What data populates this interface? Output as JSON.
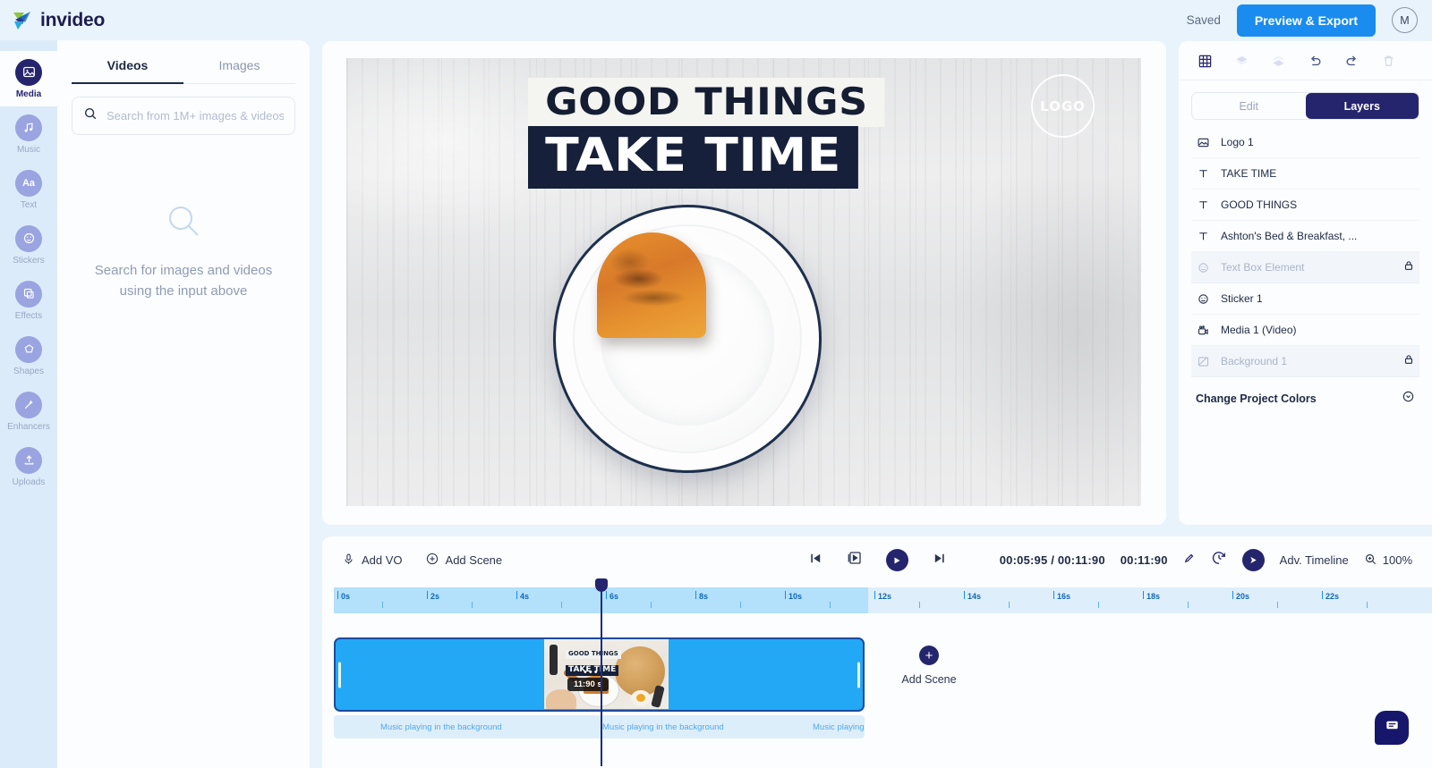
{
  "header": {
    "brand": "invideo",
    "saved_status": "Saved",
    "preview_export_label": "Preview & Export",
    "avatar_initial": "M"
  },
  "rail": {
    "items": [
      {
        "label": "Media",
        "icon": "image-icon",
        "active": true
      },
      {
        "label": "Music",
        "icon": "music-icon",
        "active": false
      },
      {
        "label": "Text",
        "icon": "text-aa-icon",
        "active": false
      },
      {
        "label": "Stickers",
        "icon": "sticker-icon",
        "active": false
      },
      {
        "label": "Effects",
        "icon": "effects-icon",
        "active": false
      },
      {
        "label": "Shapes",
        "icon": "shapes-icon",
        "active": false
      },
      {
        "label": "Enhancers",
        "icon": "wand-icon",
        "active": false
      },
      {
        "label": "Uploads",
        "icon": "upload-icon",
        "active": false
      }
    ]
  },
  "media_panel": {
    "tabs": [
      {
        "label": "Videos",
        "active": true
      },
      {
        "label": "Images",
        "active": false
      }
    ],
    "search": {
      "placeholder": "Search from 1M+ images & videos",
      "value": ""
    },
    "empty_state": {
      "line1": "Search for images and videos",
      "line2": "using the input above",
      "icon": "search-icon"
    }
  },
  "canvas": {
    "title_line1": "GOOD THINGS",
    "title_line2": "TAKE TIME",
    "logo_placeholder": "LOGO"
  },
  "right_panel": {
    "tools": [
      {
        "name": "grid-icon",
        "active": true
      },
      {
        "name": "bring-forward-icon",
        "active": false
      },
      {
        "name": "send-backward-icon",
        "active": false
      },
      {
        "name": "undo-icon",
        "active": false
      },
      {
        "name": "redo-icon",
        "active": false
      },
      {
        "name": "trash-icon",
        "active": false
      }
    ],
    "segments": [
      {
        "label": "Edit",
        "active": false
      },
      {
        "label": "Layers",
        "active": true
      }
    ],
    "layers": [
      {
        "name": "Logo 1",
        "icon": "image-layer-icon",
        "locked": false
      },
      {
        "name": "TAKE TIME",
        "icon": "text-layer-icon",
        "locked": false
      },
      {
        "name": "GOOD THINGS",
        "icon": "text-layer-icon",
        "locked": false
      },
      {
        "name": "Ashton's Bed & Breakfast, ...",
        "icon": "text-layer-icon",
        "locked": false
      },
      {
        "name": "Text Box Element",
        "icon": "sticker-layer-icon",
        "locked": true
      },
      {
        "name": "Sticker 1",
        "icon": "sticker-layer-icon",
        "locked": false
      },
      {
        "name": "Media 1 (Video)",
        "icon": "video-layer-icon",
        "locked": false
      },
      {
        "name": "Background 1",
        "icon": "background-layer-icon",
        "locked": true
      }
    ],
    "change_project_colors": "Change Project Colors"
  },
  "timeline": {
    "add_vo_label": "Add VO",
    "add_scene_label": "Add Scene",
    "transport": {
      "prev_icon": "skip-previous-icon",
      "scene_icon": "preview-scene-icon",
      "play_icon": "play-icon",
      "next_icon": "skip-next-icon"
    },
    "current_time": "00:05:95",
    "separator": "/",
    "total_time": "00:11:90",
    "scene_duration": "00:11:90",
    "edit_icon": "pencil-icon",
    "timer_icon": "timer-icon",
    "speed_icon": "speed-play-icon",
    "adv_timeline_label": "Adv. Timeline",
    "zoom_label": "100%",
    "zoom_icon": "zoom-in-icon",
    "ruler_labels": [
      "0s",
      "2s",
      "4s",
      "6s",
      "8s",
      "10s",
      "12s",
      "14s",
      "16s",
      "18s",
      "20s",
      "22s"
    ],
    "clip": {
      "duration_badge": "11:90 s",
      "dots": "•••",
      "thumb_title_line1": "GOOD THINGS",
      "thumb_title_line2": "TAKE TIME"
    },
    "add_scene_button_label": "Add Scene",
    "music_track_labels": [
      "Music playing in the background",
      "Music playing in the background",
      "Music playing"
    ]
  },
  "chat": {
    "icon": "chat-bubble-icon"
  },
  "colors": {
    "brand_navy": "#25256e",
    "accent_blue": "#1a8cf0",
    "clip_blue": "#22a8f5",
    "ruler_blue": "#b3e0fb",
    "panel_bg": "#fcfdff",
    "app_bg": "#e9f3fc"
  }
}
